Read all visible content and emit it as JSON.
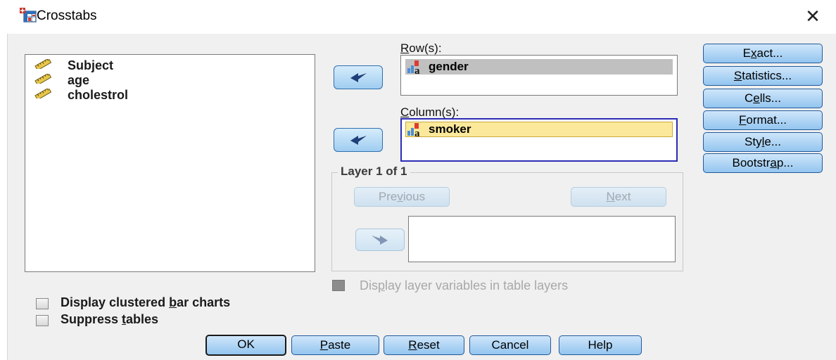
{
  "window": {
    "title": "Crosstabs",
    "icon": "crosstabs-table-icon",
    "close_glyph": "✕"
  },
  "source_list": {
    "items": [
      {
        "label": "Subject",
        "icon": "scale-ruler-icon"
      },
      {
        "label": "age",
        "icon": "scale-ruler-icon"
      },
      {
        "label": "cholestrol",
        "icon": "scale-ruler-icon"
      }
    ]
  },
  "rows": {
    "label": "Row(s):",
    "items": [
      {
        "label": "gender",
        "icon": "nominal-string-icon"
      }
    ]
  },
  "columns": {
    "label": "Column(s):",
    "items": [
      {
        "label": "smoker",
        "icon": "nominal-string-icon"
      }
    ]
  },
  "layer": {
    "title": "Layer 1 of 1",
    "previous_label": "Previous",
    "next_label": "Next",
    "display_layer_label": "Display layer variables in table layers"
  },
  "side_buttons": {
    "exact": "Exact...",
    "statistics": "Statistics...",
    "cells": "Cells...",
    "format": "Format...",
    "style": "Style...",
    "bootstrap": "Bootstrap..."
  },
  "options": {
    "clustered_bar_charts": {
      "label": "Display clustered bar charts",
      "checked": false
    },
    "suppress_tables": {
      "label": "Suppress tables",
      "checked": false
    }
  },
  "footer": {
    "ok": "OK",
    "paste": "Paste",
    "reset": "Reset",
    "cancel": "Cancel",
    "help": "Help"
  },
  "colors": {
    "button_gradient_top": "#cfe6fa",
    "button_gradient_bottom": "#93c5ef",
    "button_border": "#24599a",
    "selected_row_bg": "#c0c0c0",
    "selected_col_bg": "#fbe89a",
    "focus_border": "#2b2bb5"
  }
}
